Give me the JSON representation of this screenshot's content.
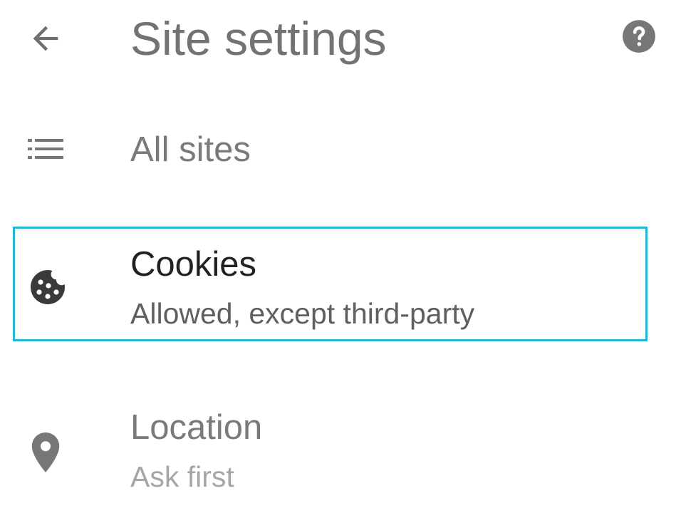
{
  "header": {
    "title": "Site settings",
    "back_icon": "arrow-left-icon",
    "help_icon": "help-circle-icon"
  },
  "items": [
    {
      "label": "All sites",
      "icon": "list-icon"
    },
    {
      "label": "Cookies",
      "sublabel": "Allowed, except third-party",
      "icon": "cookie-icon",
      "highlighted": true
    },
    {
      "label": "Location",
      "sublabel": "Ask first",
      "icon": "location-pin-icon"
    }
  ],
  "colors": {
    "highlight_border": "#1fb9d3",
    "icon_gray": "#777777",
    "icon_dark": "#3a3a3a",
    "title_gray": "#737373",
    "text_dark": "#212121"
  }
}
